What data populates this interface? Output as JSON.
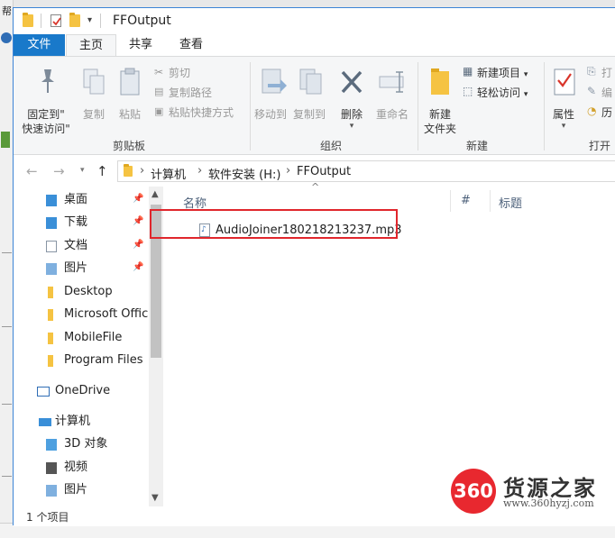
{
  "window": {
    "title": "FFOutput",
    "background_label": "帮"
  },
  "ribbon_tabs": [
    {
      "label": "文件"
    },
    {
      "label": "主页"
    },
    {
      "label": "共享"
    },
    {
      "label": "查看"
    }
  ],
  "ribbon": {
    "clipboard": {
      "pin_quick_access_line1": "固定到\"",
      "pin_quick_access_line2": "快速访问\"",
      "copy": "复制",
      "paste": "粘贴",
      "cut": "剪切",
      "copy_path": "复制路径",
      "paste_shortcut": "粘贴快捷方式",
      "group_label": "剪贴板"
    },
    "organize": {
      "move_to": "移动到",
      "copy_to": "复制到",
      "delete": "删除",
      "rename": "重命名",
      "group_label": "组织"
    },
    "new": {
      "new_folder_line1": "新建",
      "new_folder_line2": "文件夹",
      "new_item": "新建项目",
      "easy_access": "轻松访问",
      "group_label": "新建"
    },
    "open": {
      "properties": "属性",
      "open_label": "打",
      "edit_label": "编",
      "history_label": "历",
      "group_label": "打开"
    }
  },
  "address": {
    "crumbs": [
      "计算机",
      "软件安装 (H:)",
      "FFOutput"
    ]
  },
  "nav": {
    "items": [
      {
        "label": "桌面",
        "pinned": true
      },
      {
        "label": "下载",
        "pinned": true
      },
      {
        "label": "文档",
        "pinned": true
      },
      {
        "label": "图片",
        "pinned": true
      },
      {
        "label": "Desktop"
      },
      {
        "label": "Microsoft Offic"
      },
      {
        "label": "MobileFile"
      },
      {
        "label": "Program Files"
      },
      {
        "label": "OneDrive"
      },
      {
        "label": "计算机"
      },
      {
        "label": "3D 对象"
      },
      {
        "label": "视频"
      },
      {
        "label": "图片"
      }
    ]
  },
  "columns": {
    "name": "名称",
    "number": "#",
    "title": "标题"
  },
  "files": [
    {
      "name": "AudioJoiner180218213237.mp3"
    }
  ],
  "status": {
    "text": "1 个项目"
  },
  "watermark": {
    "badge": "360",
    "text": "货源之家",
    "url": "www.360hyzj.com"
  },
  "colors": {
    "accent": "#1979ca",
    "highlight": "#e0262c",
    "folder": "#f5c342"
  }
}
